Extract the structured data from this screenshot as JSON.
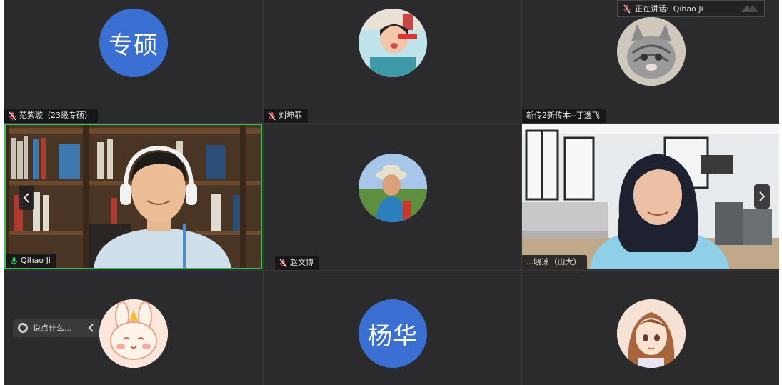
{
  "speaking_indicator": {
    "label": "正在讲话:",
    "name": "Qihao Ji"
  },
  "participants": [
    {
      "id": "p1",
      "avatar_text": "专硕",
      "avatar_color": "#3b6fd1",
      "name": "范紫璇（23级专硕）"
    },
    {
      "id": "p2",
      "avatar_icon": "child-photo-avatar",
      "name": "刘坤菲"
    },
    {
      "id": "p3",
      "avatar_icon": "cat-photo-avatar",
      "name": "新传2新传本--丁逸飞"
    },
    {
      "id": "p4",
      "video": "man-with-headphones-bookshelf",
      "name": "Qihao Ji",
      "active_speaker": true,
      "border_color": "#36c45b"
    },
    {
      "id": "p5",
      "avatar_icon": "hiker-photo-avatar",
      "name": "赵文博"
    },
    {
      "id": "p6",
      "video": "woman-in-living-room",
      "name": "...晓凉（山大）"
    },
    {
      "id": "p7",
      "avatar_icon": "bunny-cartoon-avatar"
    },
    {
      "id": "p8",
      "avatar_text": "杨华",
      "avatar_color": "#3b6fd1"
    },
    {
      "id": "p9",
      "avatar_icon": "anime-girl-avatar"
    }
  ],
  "chat": {
    "placeholder": "说点什么..."
  },
  "colors": {
    "background": "#2b2b2d",
    "active_border": "#36c45b",
    "avatar_blue": "#3b6fd1"
  }
}
